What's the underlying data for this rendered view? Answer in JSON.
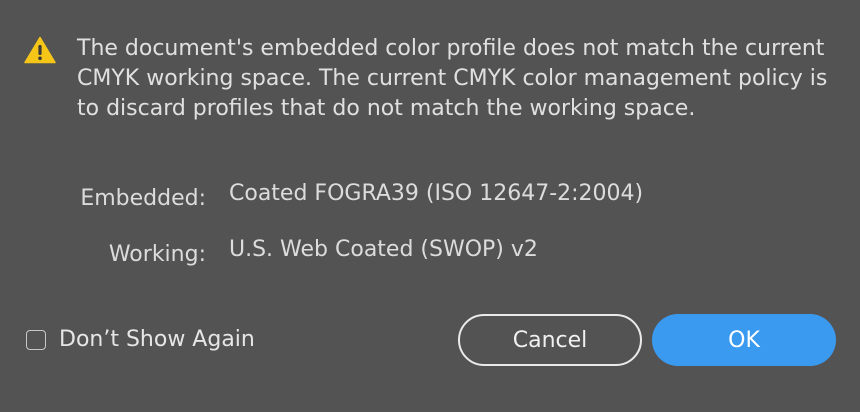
{
  "dialog": {
    "message": "The document's embedded color profile does not match the current CMYK working space. The current CMYK color management policy is to discard profiles that do not match the working space.",
    "warning_icon": "warning-triangle-icon"
  },
  "profiles": {
    "embedded_label": "Embedded:",
    "embedded_value": "Coated FOGRA39 (ISO 12647-2:2004)",
    "working_label": "Working:",
    "working_value": "U.S. Web Coated (SWOP) v2"
  },
  "footer": {
    "dont_show_again_label": "Don’t Show Again",
    "dont_show_again_checked": false,
    "cancel_label": "Cancel",
    "ok_label": "OK"
  },
  "colors": {
    "background": "#535353",
    "accent": "#3a9af0",
    "warning": "#f5c518"
  }
}
